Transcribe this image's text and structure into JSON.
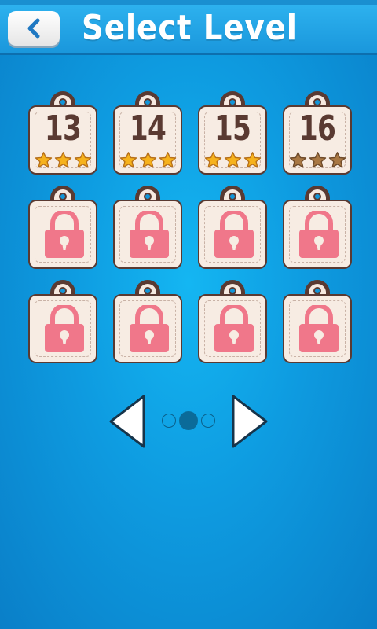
{
  "header": {
    "title": "Select Level",
    "back_icon": "chevron-left-icon"
  },
  "levels": [
    {
      "number": "13",
      "locked": false,
      "stars": 3,
      "star_style": "gold"
    },
    {
      "number": "14",
      "locked": false,
      "stars": 3,
      "star_style": "gold"
    },
    {
      "number": "15",
      "locked": false,
      "stars": 3,
      "star_style": "gold"
    },
    {
      "number": "16",
      "locked": false,
      "stars": 3,
      "star_style": "bronze"
    },
    {
      "locked": true,
      "icon": "lock-icon"
    },
    {
      "locked": true,
      "icon": "lock-icon"
    },
    {
      "locked": true,
      "icon": "lock-icon"
    },
    {
      "locked": true,
      "icon": "lock-icon"
    },
    {
      "locked": true,
      "icon": "lock-icon"
    },
    {
      "locked": true,
      "icon": "lock-icon"
    },
    {
      "locked": true,
      "icon": "lock-icon"
    },
    {
      "locked": true,
      "icon": "lock-icon"
    }
  ],
  "pager": {
    "prev_icon": "triangle-left-icon",
    "next_icon": "triangle-right-icon",
    "page_count": 3,
    "current_page": 2
  },
  "colors": {
    "background": "#0e9be0",
    "header": "#1a97dc",
    "tag_fill": "#f7ece3",
    "tag_outline": "#5a3a32",
    "lock": "#ef7a8c",
    "star_gold": "#f6b21c",
    "star_bronze": "#a97844",
    "dot_active": "#0b6b99"
  }
}
